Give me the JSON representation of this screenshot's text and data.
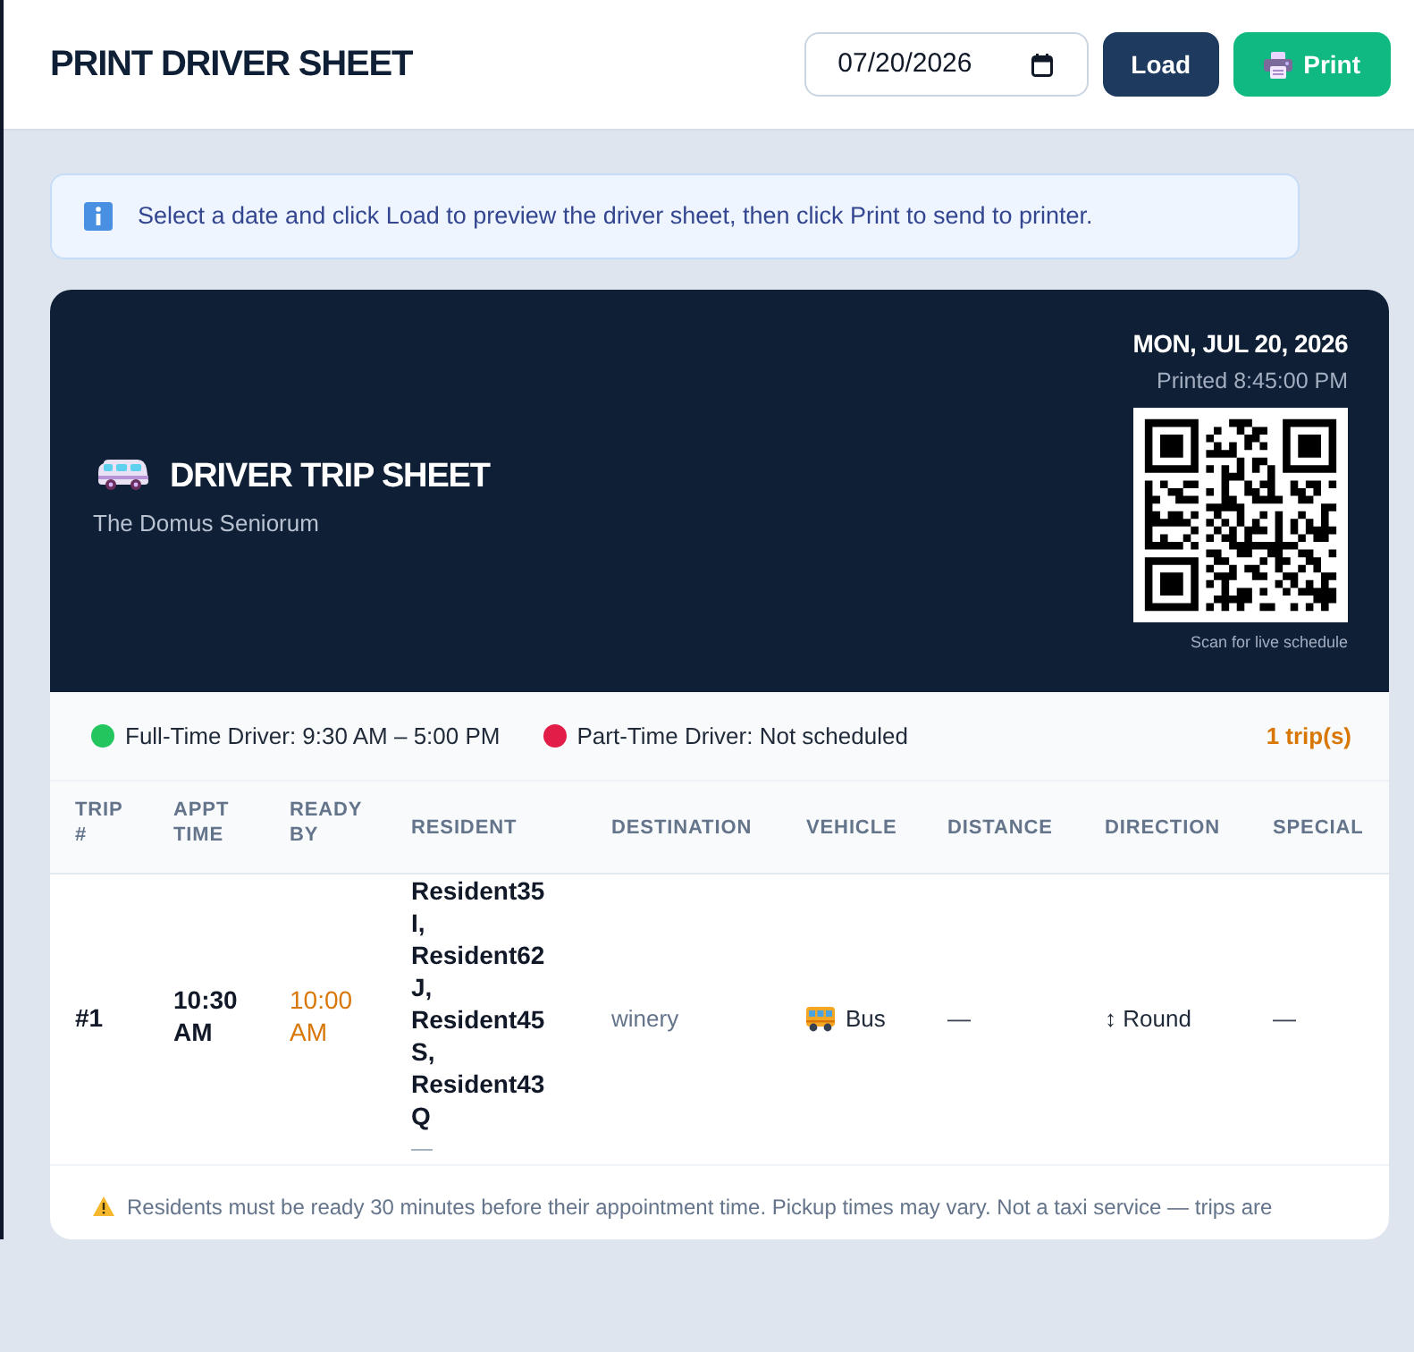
{
  "header": {
    "title": "PRINT DRIVER SHEET",
    "date_value": "07/20/2026",
    "buttons": [
      {
        "kind": "load",
        "label": "Load"
      },
      {
        "kind": "print",
        "label": "Print"
      }
    ]
  },
  "info": {
    "text": "Select a date and click Load to preview the driver sheet, then click Print to send to printer."
  },
  "sheet": {
    "title": "DRIVER TRIP SHEET",
    "subtitle": "The Domus Seniorum",
    "date": "MON, JUL 20, 2026",
    "printed": "Printed 8:45:00 PM",
    "qr_caption": "Scan for live schedule"
  },
  "drivers": [
    {
      "label": "Full-Time Driver: 9:30 AM – 5:00 PM",
      "color": "#22c55e"
    },
    {
      "label": "Part-Time Driver: Not scheduled",
      "color": "#e11d48"
    }
  ],
  "trip_count": "1 trip(s)",
  "table": {
    "columns": [
      "TRIP #",
      "APPT TIME",
      "READY BY",
      "RESIDENT",
      "DESTINATION",
      "VEHICLE",
      "DISTANCE",
      "DIRECTION",
      "SPECIAL"
    ],
    "rows": [
      {
        "trip": "#1",
        "appt_time": "10:30 AM",
        "ready_by": "10:00 AM",
        "residents": "Resident35I, Resident62J, Resident45S, Resident43Q",
        "resident_note": "—",
        "destination": "winery",
        "vehicle": "Bus",
        "distance": "—",
        "direction": "↕ Round",
        "special": "—"
      }
    ]
  },
  "footer_note": "Residents must be ready 30 minutes before their appointment time. Pickup times may vary. Not a taxi service — trips are"
}
